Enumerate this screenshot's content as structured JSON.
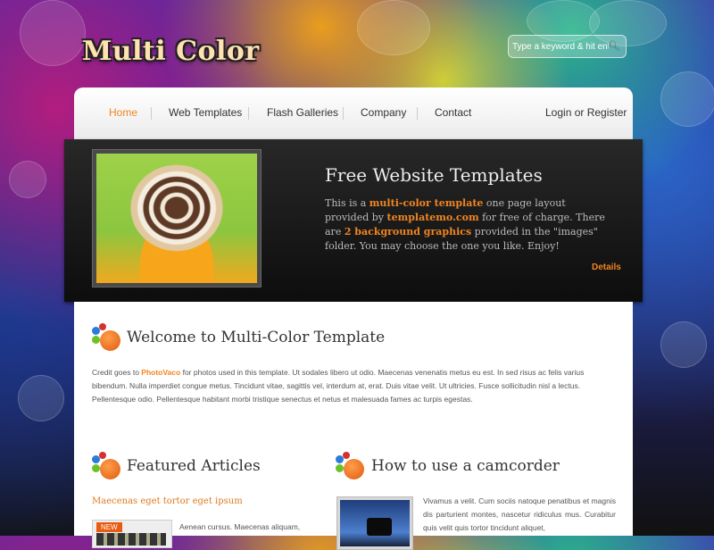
{
  "header": {
    "logo_text": "Multi Color",
    "search": {
      "placeholder": "Type a keyword & hit enter",
      "button_icon": "search-icon"
    }
  },
  "nav": {
    "items": [
      {
        "label": "Home",
        "active": true
      },
      {
        "label": "Web Templates"
      },
      {
        "label": "Flash Galleries"
      },
      {
        "label": "Company"
      },
      {
        "label": "Contact"
      }
    ],
    "login": "Login or Register"
  },
  "hero": {
    "title": "Free Website Templates",
    "text": {
      "p1": "This is a ",
      "highlight1": "multi-color template",
      "p2": " one page layout provided by ",
      "highlight2": "templatemo.com",
      "p3": " for free of charge. There are ",
      "highlight3": "2 background graphics",
      "p4": " provided in the \"images\" folder. You may choose the one you like. Enjoy!"
    },
    "details_label": "Details"
  },
  "welcome": {
    "title": "Welcome to Multi-Color Template",
    "text_before": "Credit goes to ",
    "credit": "PhotoVaco",
    "text_after": " for photos used in this template. Ut sodales libero ut odio. Maecenas venenatis metus eu est. In sed risus ac felis varius bibendum. Nulla imperdiet congue metus. Tincidunt vitae, sagittis vel, interdum at, erat. Duis vitae velit. Ut ultricies. Fusce sollicitudin nisl a lectus. Pellentesque odio. Pellentesque habitant morbi tristique senectus et netus et malesuada fames ac turpis egestas."
  },
  "featured": {
    "title": "Featured Articles",
    "article_title": "Maecenas eget tortor eget ipsum",
    "badge": "NEW",
    "excerpt": "Aenean cursus. Maecenas aliquam,"
  },
  "camcorder": {
    "title": "How to use a camcorder",
    "text": "Vivamus a velit. Cum sociis natoque penatibus et magnis dis parturient montes, nascetur ridiculus mus. Curabitur quis velit quis tortor tincidunt aliquet,"
  },
  "colors": {
    "accent": "#f08521",
    "hero_bg": "#1a1a1a",
    "nav_bg": "#f5f5f5"
  }
}
